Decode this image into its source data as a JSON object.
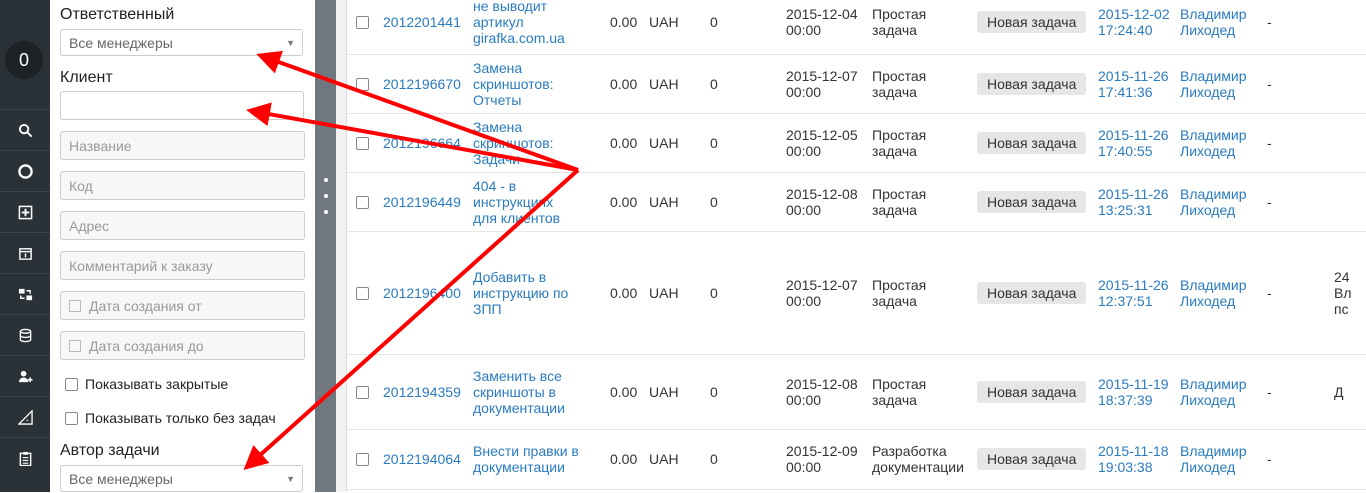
{
  "rail": {
    "badge": "0",
    "icons": [
      "search-icon",
      "lifebuoy-icon",
      "add-box-icon",
      "calendar-icon",
      "transfer-icon",
      "database-icon",
      "add-user-icon",
      "ruler-icon",
      "clipboard-icon"
    ]
  },
  "filters": {
    "responsible_label": "Ответственный",
    "responsible_value": "Все менеджеры",
    "client_label": "Клиент",
    "client_value": "",
    "name_placeholder": "Название",
    "code_placeholder": "Код",
    "address_placeholder": "Адрес",
    "comment_placeholder": "Комментарий к заказу",
    "date_from_placeholder": "Дата создания от",
    "date_to_placeholder": "Дата создания до",
    "show_closed_label": "Показывать закрытые",
    "show_no_tasks_label": "Показывать только без задач",
    "author_label": "Автор задачи",
    "author_value": "Все менеджеры"
  },
  "rows": [
    {
      "id": "2012201441",
      "title": [
        "не выводит",
        "артикул",
        "girafka.com.ua"
      ],
      "sum": "0.00",
      "cur": "UAH",
      "qty": "0",
      "due": [
        "2015-12-04",
        "00:00"
      ],
      "type": [
        "Простая",
        "задача"
      ],
      "status": "Новая задача",
      "created": [
        "2015-12-02",
        "17:24:40"
      ],
      "author": [
        "Владимир",
        "Лиходед"
      ],
      "dash": "-",
      "extra": []
    },
    {
      "id": "2012196670",
      "title": [
        "Замена",
        "скриншотов:",
        "Отчеты"
      ],
      "sum": "0.00",
      "cur": "UAH",
      "qty": "0",
      "due": [
        "2015-12-07",
        "00:00"
      ],
      "type": [
        "Простая",
        "задача"
      ],
      "status": "Новая задача",
      "created": [
        "2015-11-26",
        "17:41:36"
      ],
      "author": [
        "Владимир",
        "Лиходед"
      ],
      "dash": "-",
      "extra": []
    },
    {
      "id": "2012196664",
      "title": [
        "Замена",
        "скриншотов:",
        "Задачи"
      ],
      "sum": "0.00",
      "cur": "UAH",
      "qty": "0",
      "due": [
        "2015-12-05",
        "00:00"
      ],
      "type": [
        "Простая",
        "задача"
      ],
      "status": "Новая задача",
      "created": [
        "2015-11-26",
        "17:40:55"
      ],
      "author": [
        "Владимир",
        "Лиходед"
      ],
      "dash": "-",
      "extra": []
    },
    {
      "id": "2012196449",
      "title": [
        "404 - в",
        "инструкциях",
        "для клиентов"
      ],
      "sum": "0.00",
      "cur": "UAH",
      "qty": "0",
      "due": [
        "2015-12-08",
        "00:00"
      ],
      "type": [
        "Простая",
        "задача"
      ],
      "status": "Новая задача",
      "created": [
        "2015-11-26",
        "13:25:31"
      ],
      "author": [
        "Владимир",
        "Лиходед"
      ],
      "dash": "-",
      "extra": []
    },
    {
      "id": "2012196400",
      "title": [
        "Добавить в",
        "инструкцию по",
        "ЗПП"
      ],
      "sum": "0.00",
      "cur": "UAH",
      "qty": "0",
      "due": [
        "2015-12-07",
        "00:00"
      ],
      "type": [
        "Простая",
        "задача"
      ],
      "status": "Новая задача",
      "created": [
        "2015-11-26",
        "12:37:51"
      ],
      "author": [
        "Владимир",
        "Лиходед"
      ],
      "dash": "-",
      "extra": [
        "24",
        "Вл",
        "пс"
      ]
    },
    {
      "id": "2012194359",
      "title": [
        "Заменить все",
        "скриншоты в",
        "документации"
      ],
      "sum": "0.00",
      "cur": "UAH",
      "qty": "0",
      "due": [
        "2015-12-08",
        "00:00"
      ],
      "type": [
        "Простая",
        "задача"
      ],
      "status": "Новая задача",
      "created": [
        "2015-11-19",
        "18:37:39"
      ],
      "author": [
        "Владимир",
        "Лиходед"
      ],
      "dash": "-",
      "extra": [
        "Д"
      ]
    },
    {
      "id": "2012194064",
      "title": [
        "Внести правки в",
        "документации"
      ],
      "sum": "0.00",
      "cur": "UAH",
      "qty": "0",
      "due": [
        "2015-12-09",
        "00:00"
      ],
      "type": [
        "Разработка",
        "документации"
      ],
      "status": "Новая задача",
      "created": [
        "2015-11-18",
        "19:03:38"
      ],
      "author": [
        "Владимир",
        "Лиходед"
      ],
      "dash": "-",
      "extra": []
    }
  ]
}
